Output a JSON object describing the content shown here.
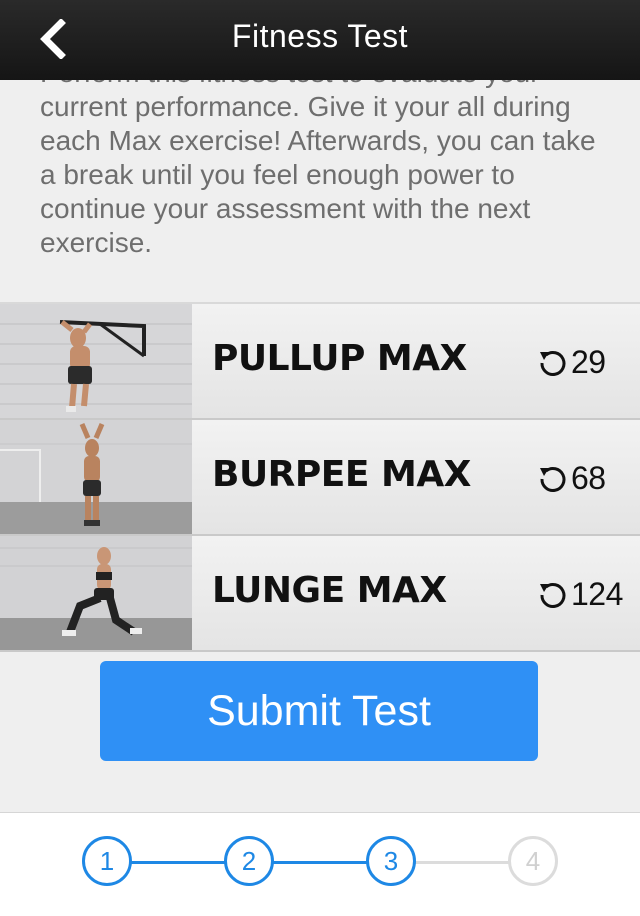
{
  "header": {
    "title": "Fitness Test",
    "back_icon": "chevron-left-icon"
  },
  "intro": {
    "text": "Perform this fitness test to evaluate your current performance. Give it your all during each Max exercise! Afterwards, you can take a break until you feel enough power to continue your assessment with the next exercise."
  },
  "exercises": [
    {
      "name": "PULLUP MAX",
      "reps": "29",
      "icon": "repeat-icon"
    },
    {
      "name": "BURPEE MAX",
      "reps": "68",
      "icon": "repeat-icon"
    },
    {
      "name": "LUNGE MAX",
      "reps": "124",
      "icon": "repeat-icon"
    }
  ],
  "submit": {
    "label": "Submit Test"
  },
  "progress": {
    "steps": [
      "1",
      "2",
      "3",
      "4"
    ],
    "current": 3,
    "accent": "#1e88e5",
    "inactive": "#dcdcdc"
  }
}
